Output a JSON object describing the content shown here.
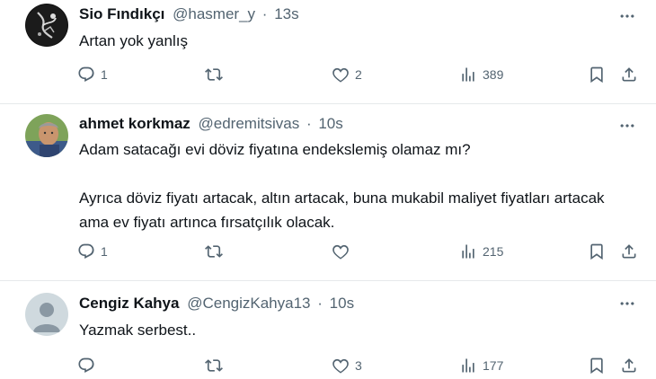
{
  "tweets": [
    {
      "name": "Sio Fındıkçı",
      "handle": "@hasmer_y",
      "separator": "·",
      "time": "13s",
      "text": [
        "Artan yok yanlış"
      ],
      "replies": "1",
      "retweets": "",
      "likes": "2",
      "views": "389"
    },
    {
      "name": "ahmet korkmaz",
      "handle": "@edremitsivas",
      "separator": "·",
      "time": "10s",
      "text": [
        "Adam satacağı evi döviz fiyatına endekslemiş olamaz mı?",
        "Ayrıca döviz fiyatı artacak, altın artacak, buna mukabil maliyet fiyatları artacak ama ev fiyatı artınca fırsatçılık olacak."
      ],
      "replies": "1",
      "retweets": "",
      "likes": "",
      "views": "215"
    },
    {
      "name": "Cengiz Kahya",
      "handle": "@CengizKahya13",
      "separator": "·",
      "time": "10s",
      "text": [
        "Yazmak serbest.."
      ],
      "replies": "",
      "retweets": "",
      "likes": "3",
      "views": "177"
    }
  ],
  "colors": {
    "text": "#0f1419",
    "secondary": "#536471",
    "divider": "#e6e9eb",
    "default_avatar": "#cfd9de"
  },
  "icons": [
    "reply-icon",
    "retweet-icon",
    "like-icon",
    "views-icon",
    "bookmark-icon",
    "share-icon",
    "more-icon"
  ]
}
